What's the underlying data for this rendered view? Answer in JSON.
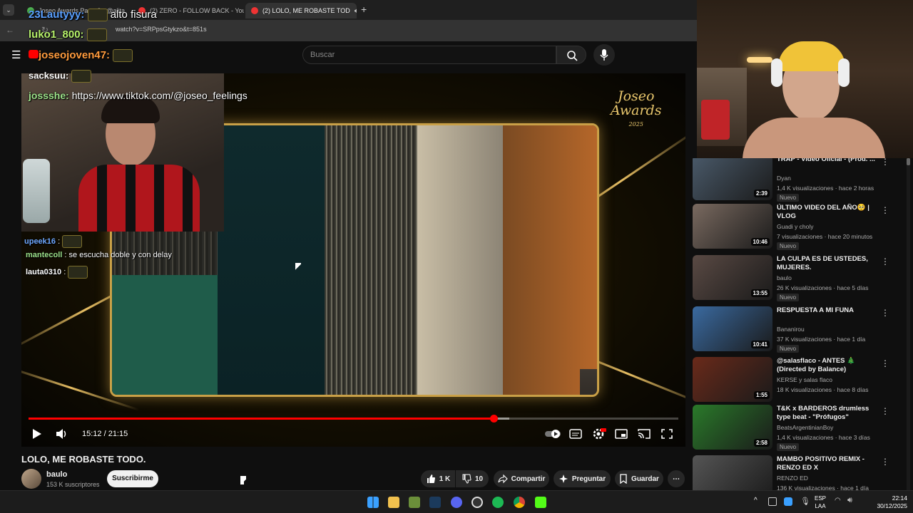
{
  "browser": {
    "tabs": [
      {
        "label": "Joseo Awards Parte 2 - @alita"
      },
      {
        "label": "(2) ZERO - FOLLOW BACK - You"
      },
      {
        "label": "(2) LOLO, ME ROBASTE TOD"
      }
    ],
    "url": "watch?v=SRPpsGtykzo&t=851s"
  },
  "youtube": {
    "search_placeholder": "Buscar"
  },
  "overlay_chat": {
    "top_user": "23Lautyyy:",
    "top_msg": "alto fisura",
    "lines": [
      {
        "user": "luko1_800:",
        "msg": ""
      },
      {
        "user": "joseojoven47:",
        "msg": ""
      },
      {
        "user": "sacksuu:",
        "msg": ""
      },
      {
        "user": "jossshe:",
        "msg": "https://www.tiktok.com/@joseo_feelings"
      },
      {
        "user": "upeek16",
        "msg": ""
      },
      {
        "user": "mantecoll",
        "msg": "se escucha doble y con delay"
      },
      {
        "user": "lauta0310",
        "msg": ""
      }
    ]
  },
  "player": {
    "logo_line1": "Joseo",
    "logo_line2": "Awards",
    "logo_year": "2025",
    "time": "15:12 / 21:15",
    "progress_fraction": 0.7153,
    "buffer_fraction": 0.74
  },
  "video": {
    "title": "LOLO, ME ROBASTE TODO.",
    "channel": "baulo",
    "subscribers": "153 K suscriptores",
    "subscribe_label": "Suscribirme",
    "likes": "1 K",
    "dislikes": "10",
    "share_label": "Compartir",
    "ask_label": "Preguntar",
    "save_label": "Guardar"
  },
  "recommendations": [
    {
      "title": "TRAP - Video Oficial - (Prod. ...",
      "channel": "Dyan",
      "meta": "1,4 K visualizaciones · hace 2 horas",
      "duration": "2:39",
      "badge": "Nuevo",
      "thumb_color": "#4a5a6a"
    },
    {
      "title": "ÚLTIMO VIDEO DEL AÑO🥺 | VLOG",
      "channel": "Guadi y choly",
      "meta": "7 visualizaciones · hace 20 minutos",
      "duration": "10:46",
      "badge": "Nuevo",
      "thumb_color": "#7a6a60"
    },
    {
      "title": "LA CULPA ES DE USTEDES, MUJERES.",
      "channel": "baulo",
      "meta": "26 K visualizaciones · hace 5 días",
      "duration": "13:55",
      "badge": "Nuevo",
      "thumb_color": "#5a4a44"
    },
    {
      "title": "RESPUESTA A MI FUNA",
      "channel": "Bananirou",
      "meta": "37 K visualizaciones · hace 1 día",
      "duration": "10:41",
      "badge": "Nuevo",
      "thumb_color": "#3a6aa0"
    },
    {
      "title": "@salasflaco - ANTES 🎄 (Directed by Balance)",
      "channel": "KERSE y salas flaco",
      "meta": "18 K visualizaciones · hace 8 días",
      "duration": "1:55",
      "badge": "",
      "thumb_color": "#6a2a1a"
    },
    {
      "title": "T&K x BARDEROS drumless type beat - \"Prófugos\"",
      "channel": "BeatsArgentinianBoy",
      "meta": "1,4 K visualizaciones · hace 3 días",
      "duration": "2:58",
      "badge": "Nuevo",
      "thumb_color": "#2a7a2a"
    },
    {
      "title": "MAMBO POSITIVO REMIX - RENZO ED X BENJITALKAPON...",
      "channel": "RENZO ED",
      "meta": "136 K visualizaciones · hace 1 día",
      "duration": "",
      "badge": "",
      "thumb_color": "#555555"
    }
  ],
  "taskbar": {
    "lang_line1": "ESP",
    "lang_line2": "LAA",
    "time": "22:14",
    "date": "30/12/2025"
  }
}
